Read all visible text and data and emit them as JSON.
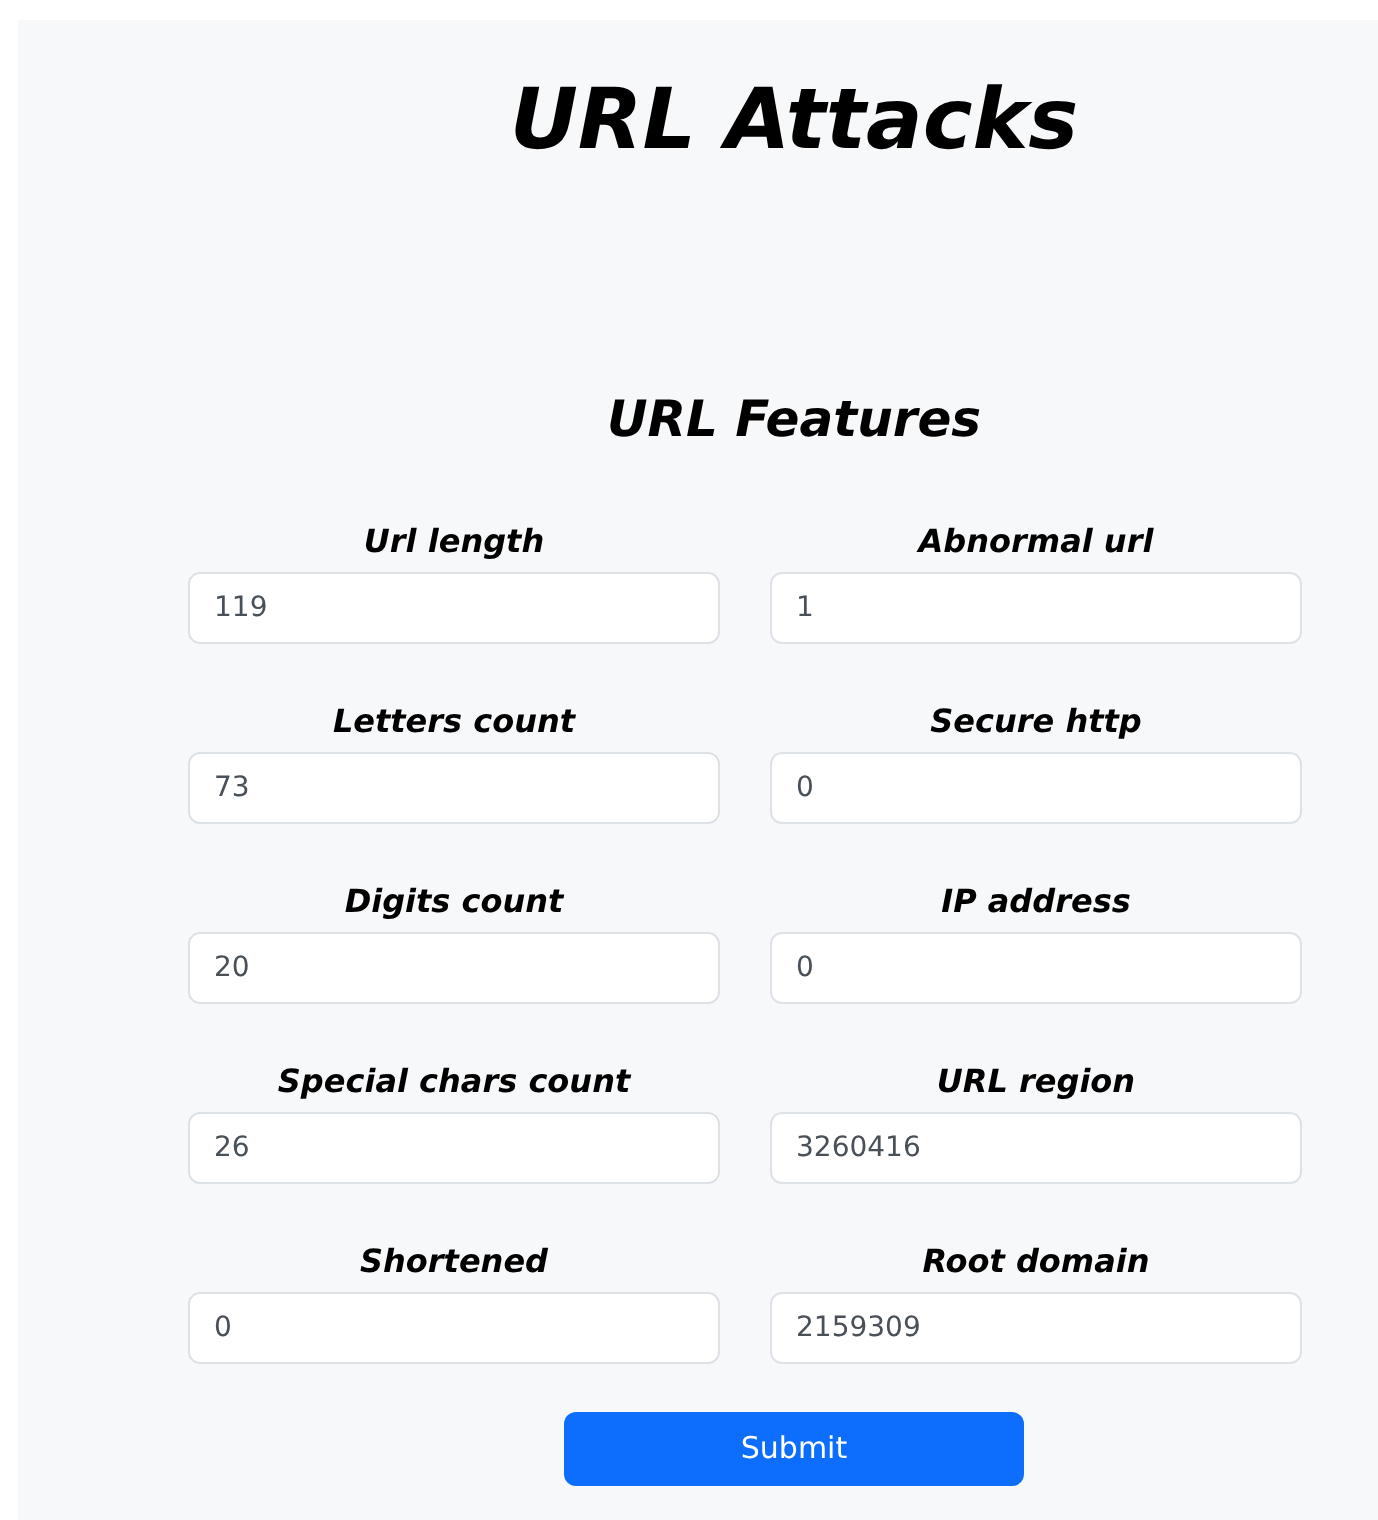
{
  "title": "URL Attacks",
  "form": {
    "heading": "URL Features",
    "fields": [
      {
        "label": "Url length",
        "value": "119"
      },
      {
        "label": "Abnormal url",
        "value": "1"
      },
      {
        "label": "Letters count",
        "value": "73"
      },
      {
        "label": "Secure http",
        "value": "0"
      },
      {
        "label": "Digits count",
        "value": "20"
      },
      {
        "label": "IP address",
        "value": "0"
      },
      {
        "label": "Special chars count",
        "value": "26"
      },
      {
        "label": "URL region",
        "value": "3260416"
      },
      {
        "label": "Shortened",
        "value": "0"
      },
      {
        "label": "Root domain",
        "value": "2159309"
      }
    ],
    "submit": "Submit"
  }
}
